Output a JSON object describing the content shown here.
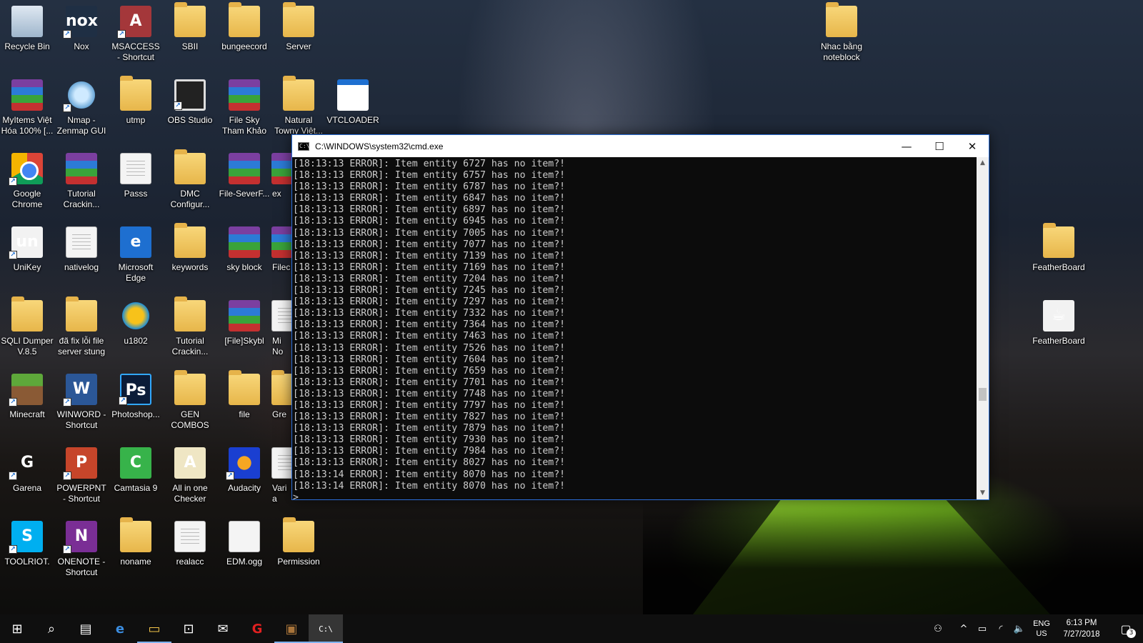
{
  "desktop": {
    "icons": {
      "recycle_bin": "Recycle Bin",
      "nox": "Nox",
      "msaccess": "MSACCESS - Shortcut",
      "sbii": "SBII",
      "bungeecord": "bungeecord",
      "server": "Server",
      "nhac_bang": "Nhac bằng noteblock",
      "myitems": "MyItems Việt Hóa 100% [...",
      "nmap": "Nmap - Zenmap GUI",
      "utmp": "utmp",
      "obs": "OBS Studio",
      "file_sky": "File Sky Tham Khảo",
      "natural_towny": "Natural Towny Việt...",
      "vtcloader": "VTCLOADER",
      "chrome": "Google Chrome",
      "tutorial_1": "Tutorial Crackin...",
      "passs": "Passs",
      "dmc": "DMC Configur...",
      "file_sever": "File-SeverF...",
      "ex_partial": "ex",
      "unikey": "UniKey",
      "nativelog": "nativelog",
      "edge": "Microsoft Edge",
      "keywords": "keywords",
      "sky_block": "sky block",
      "filec_partial": "Filec",
      "featherboard_folder": "FeatherBoard",
      "sqli": "SQLI Dumper V.8.5",
      "da_fix": "đã fix lỗi file server stung",
      "u1802": "u1802",
      "tutorial_2": "Tutorial Crackin...",
      "file_skybl": "[File]Skybl",
      "mi_partial": "Mi No",
      "featherboard_java": "FeatherBoard",
      "minecraft": "Minecraft",
      "winword": "WINWORD - Shortcut",
      "photoshop": "Photoshop...",
      "gen_combos": "GEN COMBOS",
      "file": "file",
      "gre_partial": "Gre",
      "garena": "Garena",
      "powerpnt": "POWERPNT - Shortcut",
      "camtasia": "Camtasia 9",
      "all_in_one": "All in one Checker",
      "audacity": "Audacity",
      "vari_partial": "Varia",
      "toolriot": "TOOLRIOT.",
      "onenote": "ONENOTE - Shortcut",
      "noname": "noname",
      "realacc": "realacc",
      "edm": "EDM.ogg",
      "permission": "Permission"
    }
  },
  "cmd_window": {
    "title": "C:\\WINDOWS\\system32\\cmd.exe",
    "minimize_glyph": "—",
    "maximize_glyph": "☐",
    "close_glyph": "✕",
    "lines": [
      "[18:13:13 ERROR]: Item entity 6727 has no item?!",
      "[18:13:13 ERROR]: Item entity 6757 has no item?!",
      "[18:13:13 ERROR]: Item entity 6787 has no item?!",
      "[18:13:13 ERROR]: Item entity 6847 has no item?!",
      "[18:13:13 ERROR]: Item entity 6897 has no item?!",
      "[18:13:13 ERROR]: Item entity 6945 has no item?!",
      "[18:13:13 ERROR]: Item entity 7005 has no item?!",
      "[18:13:13 ERROR]: Item entity 7077 has no item?!",
      "[18:13:13 ERROR]: Item entity 7139 has no item?!",
      "[18:13:13 ERROR]: Item entity 7169 has no item?!",
      "[18:13:13 ERROR]: Item entity 7204 has no item?!",
      "[18:13:13 ERROR]: Item entity 7245 has no item?!",
      "[18:13:13 ERROR]: Item entity 7297 has no item?!",
      "[18:13:13 ERROR]: Item entity 7332 has no item?!",
      "[18:13:13 ERROR]: Item entity 7364 has no item?!",
      "[18:13:13 ERROR]: Item entity 7463 has no item?!",
      "[18:13:13 ERROR]: Item entity 7526 has no item?!",
      "[18:13:13 ERROR]: Item entity 7604 has no item?!",
      "[18:13:13 ERROR]: Item entity 7659 has no item?!",
      "[18:13:13 ERROR]: Item entity 7701 has no item?!",
      "[18:13:13 ERROR]: Item entity 7748 has no item?!",
      "[18:13:13 ERROR]: Item entity 7797 has no item?!",
      "[18:13:13 ERROR]: Item entity 7827 has no item?!",
      "[18:13:13 ERROR]: Item entity 7879 has no item?!",
      "[18:13:13 ERROR]: Item entity 7930 has no item?!",
      "[18:13:13 ERROR]: Item entity 7984 has no item?!",
      "[18:13:13 ERROR]: Item entity 8027 has no item?!",
      "[18:13:14 ERROR]: Item entity 8070 has no item?!",
      "[18:13:14 ERROR]: Item entity 8070 has no item?!",
      ">_"
    ]
  },
  "taskbar": {
    "start_glyph": "⊞",
    "search_glyph": "⌕",
    "taskview_glyph": "▤",
    "edge_glyph": "e",
    "explorer_glyph": "▭",
    "store_glyph": "⊡",
    "mail_glyph": "✉",
    "garena_glyph": "G",
    "minecraft_glyph": "▣",
    "cmd_glyph": "C:\\",
    "tray": {
      "people_glyph": "⚇",
      "chevron_glyph": "^",
      "battery_glyph": "▭",
      "network_glyph": "◜",
      "volume_glyph": "🔈",
      "lang_line1": "ENG",
      "lang_line2": "US",
      "time": "6:13 PM",
      "date": "7/27/2018",
      "notification_glyph": "▢",
      "notification_count": "3"
    }
  }
}
